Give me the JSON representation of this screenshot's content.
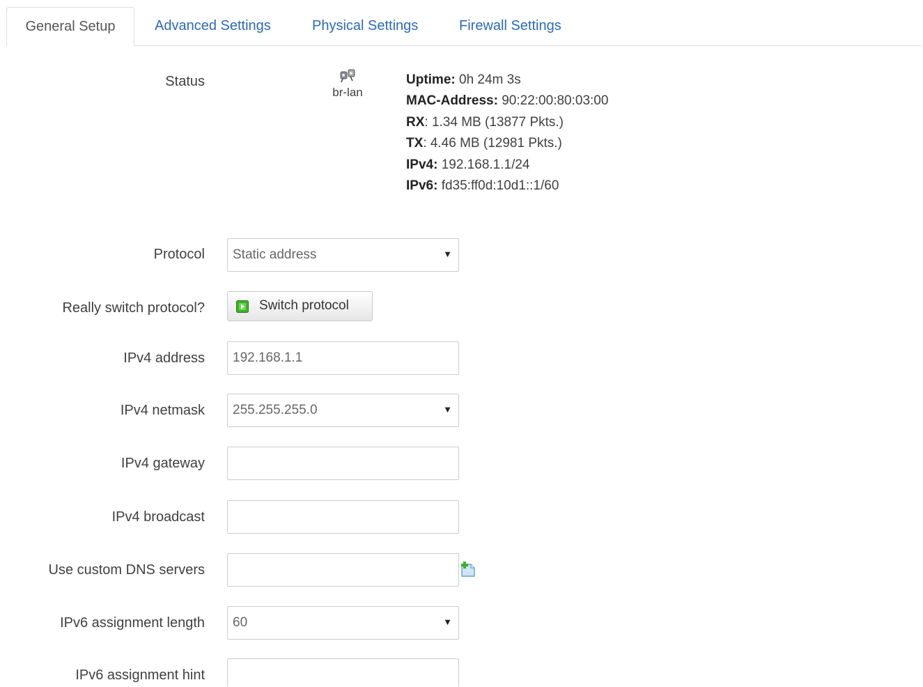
{
  "tabs": [
    {
      "label": "General Setup",
      "active": true
    },
    {
      "label": "Advanced Settings",
      "active": false
    },
    {
      "label": "Physical Settings",
      "active": false
    },
    {
      "label": "Firewall Settings",
      "active": false
    }
  ],
  "status": {
    "label": "Status",
    "interface_name": "br-lan",
    "uptime_label": "Uptime:",
    "uptime_value": "0h 24m 3s",
    "mac_label": "MAC-Address:",
    "mac_value": "90:22:00:80:03:00",
    "rx_label": "RX",
    "rx_value": ": 1.34 MB (13877 Pkts.)",
    "tx_label": "TX",
    "tx_value": ": 4.46 MB (12981 Pkts.)",
    "ipv4_label": "IPv4:",
    "ipv4_value": "192.168.1.1/24",
    "ipv6_label": "IPv6:",
    "ipv6_value": "fd35:ff0d:10d1::1/60"
  },
  "form": {
    "protocol": {
      "label": "Protocol",
      "value": "Static address"
    },
    "switch": {
      "label": "Really switch protocol?",
      "button": "Switch protocol"
    },
    "ipv4_address": {
      "label": "IPv4 address",
      "value": "192.168.1.1"
    },
    "ipv4_netmask": {
      "label": "IPv4 netmask",
      "value": "255.255.255.0"
    },
    "ipv4_gateway": {
      "label": "IPv4 gateway",
      "value": ""
    },
    "ipv4_broadcast": {
      "label": "IPv4 broadcast",
      "value": ""
    },
    "dns": {
      "label": "Use custom DNS servers",
      "value": ""
    },
    "ipv6_length": {
      "label": "IPv6 assignment length",
      "value": "60"
    },
    "ipv6_hint": {
      "label": "IPv6 assignment hint",
      "value": ""
    }
  },
  "icons": {
    "interface": "network-interface-icon",
    "apply": "apply-icon",
    "add": "add-entry-icon",
    "dropdown": "dropdown-arrow-icon"
  },
  "colors": {
    "link": "#2b6ab8",
    "border": "#cccccc",
    "apply_green": "#3fae29"
  }
}
